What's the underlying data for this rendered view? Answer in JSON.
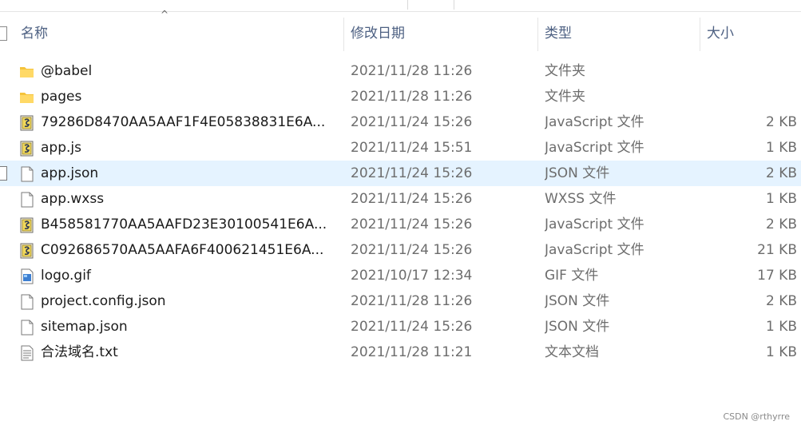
{
  "header": {
    "name": "名称",
    "date": "修改日期",
    "type": "类型",
    "size": "大小",
    "sort_indicator": "^"
  },
  "files": [
    {
      "name": "@babel",
      "date": "2021/11/28 11:26",
      "type": "文件夹",
      "size": "",
      "icon": "folder-icon"
    },
    {
      "name": "pages",
      "date": "2021/11/28 11:26",
      "type": "文件夹",
      "size": "",
      "icon": "folder-icon"
    },
    {
      "name": "79286D8470AA5AAF1F4E05838831E6A...",
      "date": "2021/11/24 15:26",
      "type": "JavaScript 文件",
      "size": "2 KB",
      "icon": "javascript-file-icon"
    },
    {
      "name": "app.js",
      "date": "2021/11/24 15:51",
      "type": "JavaScript 文件",
      "size": "1 KB",
      "icon": "javascript-file-icon"
    },
    {
      "name": "app.json",
      "date": "2021/11/24 15:26",
      "type": "JSON 文件",
      "size": "2 KB",
      "icon": "blank-file-icon",
      "selected": true
    },
    {
      "name": "app.wxss",
      "date": "2021/11/24 15:26",
      "type": "WXSS 文件",
      "size": "1 KB",
      "icon": "blank-file-icon"
    },
    {
      "name": "B458581770AA5AAFD23E30100541E6A...",
      "date": "2021/11/24 15:26",
      "type": "JavaScript 文件",
      "size": "2 KB",
      "icon": "javascript-file-icon"
    },
    {
      "name": "C092686570AA5AAFA6F400621451E6A...",
      "date": "2021/11/24 15:26",
      "type": "JavaScript 文件",
      "size": "21 KB",
      "icon": "javascript-file-icon"
    },
    {
      "name": "logo.gif",
      "date": "2021/10/17 12:34",
      "type": "GIF 文件",
      "size": "17 KB",
      "icon": "image-file-icon"
    },
    {
      "name": "project.config.json",
      "date": "2021/11/28 11:26",
      "type": "JSON 文件",
      "size": "2 KB",
      "icon": "blank-file-icon"
    },
    {
      "name": "sitemap.json",
      "date": "2021/11/24 15:26",
      "type": "JSON 文件",
      "size": "1 KB",
      "icon": "blank-file-icon"
    },
    {
      "name": "合法域名.txt",
      "date": "2021/11/28 11:21",
      "type": "文本文档",
      "size": "1 KB",
      "icon": "text-file-icon"
    }
  ],
  "watermark": "CSDN @rthyrre",
  "colors": {
    "header_text": "#4d6082",
    "selection_background": "#e5f3ff",
    "folder_yellow": "#f5c33b",
    "muted_text": "#6d6d6d"
  }
}
